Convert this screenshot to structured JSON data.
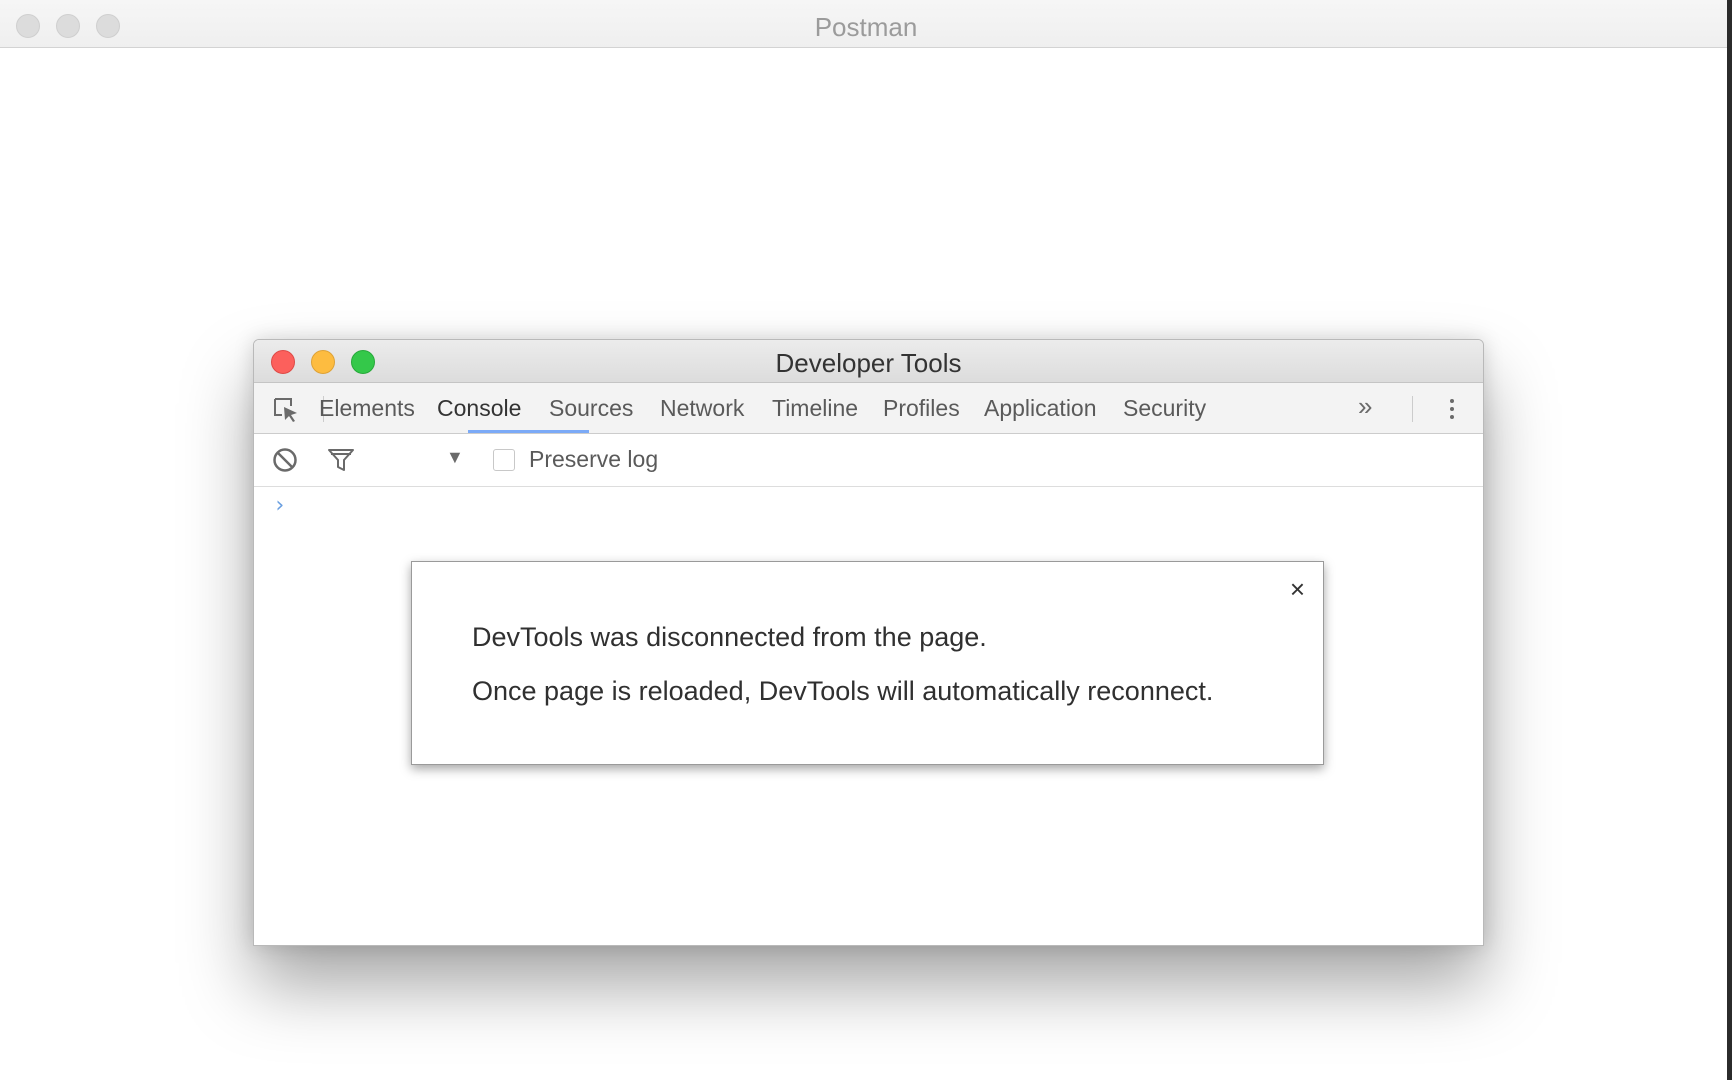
{
  "postman": {
    "title": "Postman"
  },
  "devtools": {
    "title": "Developer Tools",
    "tabs": [
      {
        "label": "Elements",
        "active": false
      },
      {
        "label": "Console",
        "active": true
      },
      {
        "label": "Sources",
        "active": false
      },
      {
        "label": "Network",
        "active": false
      },
      {
        "label": "Timeline",
        "active": false
      },
      {
        "label": "Profiles",
        "active": false
      },
      {
        "label": "Application",
        "active": false
      },
      {
        "label": "Security",
        "active": false
      }
    ],
    "more_tabs_glyph": "»",
    "toolbar": {
      "dropdown_glyph": "▼",
      "preserve_log_label": "Preserve log",
      "preserve_log_checked": false
    },
    "console": {
      "prompt_glyph": "›"
    },
    "dialog": {
      "close_glyph": "×",
      "line1": "DevTools was disconnected from the page.",
      "line2": "Once page is reloaded, DevTools will automatically reconnect."
    }
  },
  "icons": {
    "inspect": "inspect-element-icon",
    "clear": "clear-console-icon",
    "filter": "filter-icon",
    "kebab": "more-options-icon"
  },
  "colors": {
    "traffic_close": "#fc605c",
    "traffic_minimize": "#fdbc40",
    "traffic_maximize": "#34c84a",
    "active_tab_underline": "#7baaf7",
    "prompt": "#6a9fe0"
  }
}
